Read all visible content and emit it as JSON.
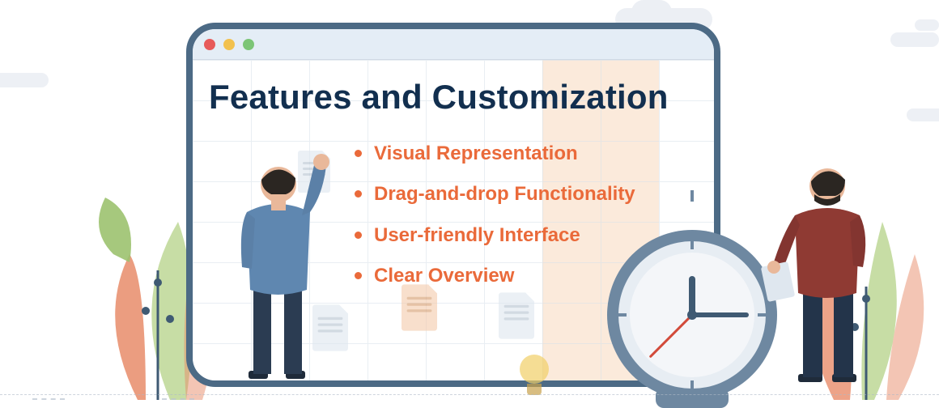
{
  "heading": "Features and Customization",
  "bullets": [
    "Visual Representation",
    "Drag-and-drop Functionality",
    "User-friendly Interface",
    "Clear Overview"
  ],
  "colors": {
    "heading": "#122f4f",
    "bullet": "#ea6a3a",
    "window_frame": "#4c6a85"
  }
}
